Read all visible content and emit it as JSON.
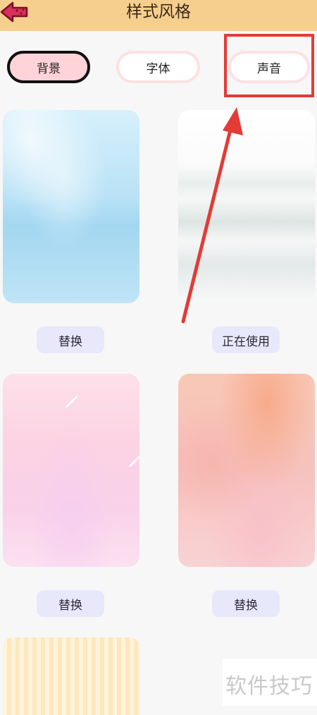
{
  "header": {
    "title": "样式风格",
    "back_icon": "back-arrow-icon"
  },
  "tabs": [
    {
      "label": "背景",
      "selected": true
    },
    {
      "label": "字体",
      "selected": false
    },
    {
      "label": "声音",
      "selected": false
    }
  ],
  "cards": [
    {
      "button_label": "替换"
    },
    {
      "button_label": "正在使用"
    },
    {
      "button_label": "替换"
    },
    {
      "button_label": "替换"
    }
  ],
  "watermark": "软件技巧",
  "colors": {
    "header": "#f6cf8e",
    "selected_tab": "#ffd3d8",
    "annotation": "#e33b36",
    "button": "#e8e8fb"
  }
}
